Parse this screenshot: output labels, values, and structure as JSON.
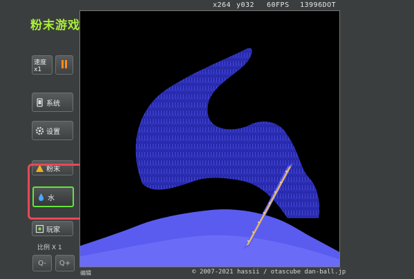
{
  "app": {
    "title": "粉末游戏"
  },
  "status": {
    "x": "x264",
    "y": "y032",
    "fps": "60FPS",
    "dot": "13996DOT"
  },
  "sidebar": {
    "speed_label": "速度x1",
    "system_label": "系统",
    "settings_label": "设置",
    "powder_label": "粉末",
    "water_label": "水",
    "player_label": "玩家",
    "scale_label": "比例 X 1",
    "zoom_out_label": "Q-",
    "zoom_in_label": "Q+"
  },
  "footer": {
    "edit_label": "编辑",
    "copyright": "© 2007-2021 hassii / otascube dan-ball.jp"
  },
  "colors": {
    "title": "#a8ee3a",
    "water": "#4a4ef0",
    "highlight": "#e8485a",
    "active_border": "#63e63a",
    "pause": "#ff8a1a"
  }
}
